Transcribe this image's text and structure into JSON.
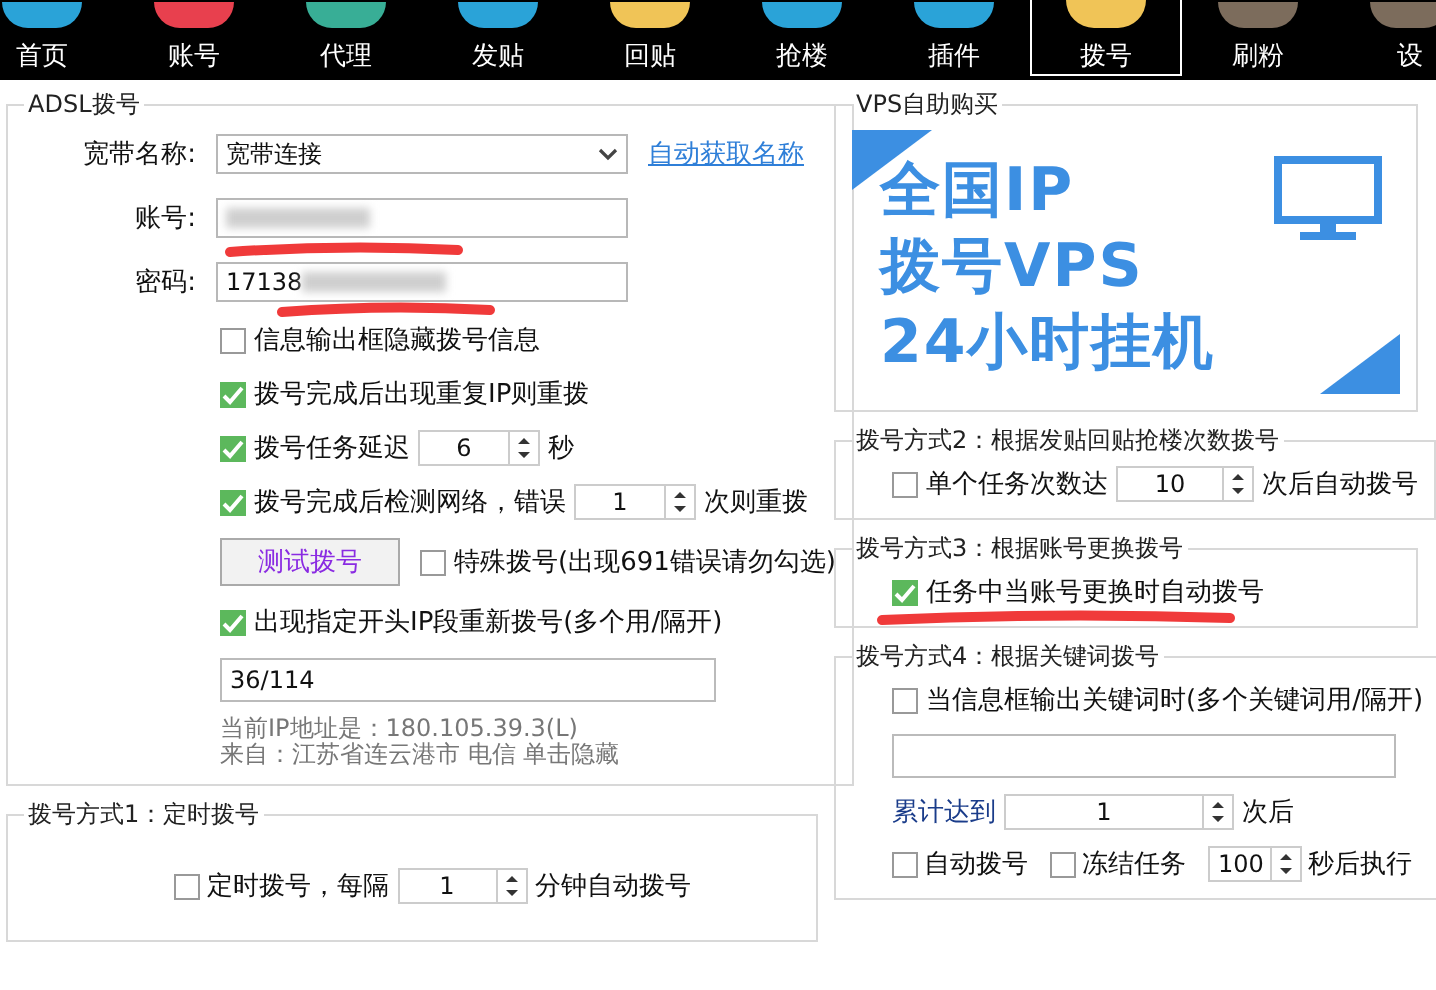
{
  "toolbar": {
    "items": [
      {
        "label": "首页",
        "color": "#2aa3d8",
        "selected": false
      },
      {
        "label": "账号",
        "color": "#e8404e",
        "selected": false
      },
      {
        "label": "代理",
        "color": "#38ae96",
        "selected": false
      },
      {
        "label": "发贴",
        "color": "#2aa3d8",
        "selected": false
      },
      {
        "label": "回贴",
        "color": "#f0c457",
        "selected": false
      },
      {
        "label": "抢楼",
        "color": "#2aa3d8",
        "selected": false
      },
      {
        "label": "插件",
        "color": "#2aa3d8",
        "selected": false
      },
      {
        "label": "拨号",
        "color": "#f0c457",
        "selected": true
      },
      {
        "label": "刷粉",
        "color": "#7c6c5c",
        "selected": false
      },
      {
        "label": "设",
        "color": "#7c6c5c",
        "selected": false
      }
    ]
  },
  "adsl": {
    "title": "ADSL拨号",
    "fields": [
      {
        "kind": "select",
        "label": "宽带名称:",
        "value": "宽带连接",
        "link": "自动获取名称"
      },
      {
        "kind": "text",
        "label": "账号:",
        "blurred": true,
        "marked": true
      },
      {
        "kind": "text",
        "label": "密码:",
        "value": "17138",
        "blurred": true,
        "marked": true
      }
    ],
    "options": [
      {
        "kind": "check",
        "label": "信息输出框隐藏拨号信息",
        "checked": false
      },
      {
        "kind": "check",
        "label": "拨号完成后出现重复IP则重拨",
        "checked": true
      },
      {
        "kind": "check_spin",
        "label": "拨号任务延迟",
        "checked": true,
        "value": "6",
        "suffix": "秒"
      },
      {
        "kind": "check_spin",
        "label": "拨号完成后检测网络，错误",
        "checked": true,
        "value": "1",
        "suffix": "次则重拨"
      },
      {
        "kind": "button_check",
        "button": "测试拨号",
        "label": "特殊拨号(出现691错误请勿勾选)",
        "checked": false
      },
      {
        "kind": "check",
        "label": "出现指定开头IP段重新拨号(多个用/隔开)",
        "checked": true
      },
      {
        "kind": "input",
        "value": "36/114"
      }
    ],
    "ip_info": [
      "当前IP地址是：180.105.39.3(L)",
      "来自：江苏省连云港市 电信   单击隐藏"
    ]
  },
  "method1": {
    "title": "拨号方式1：定时拨号",
    "options": [
      {
        "kind": "check_spin",
        "label": "定时拨号，每隔",
        "checked": false,
        "value": "1",
        "suffix": "分钟自动拨号"
      }
    ]
  },
  "vps": {
    "title": "VPS自助购买",
    "banner_lines": [
      "全国IP",
      "拨号VPS",
      "24小时挂机"
    ]
  },
  "method2": {
    "title": "拨号方式2：根据发贴回贴抢楼次数拨号",
    "options": [
      {
        "kind": "check_spin",
        "label": "单个任务次数达",
        "checked": false,
        "value": "10",
        "suffix": "次后自动拨号"
      }
    ]
  },
  "method3": {
    "title": "拨号方式3：根据账号更换拨号",
    "options": [
      {
        "kind": "check",
        "label": "任务中当账号更换时自动拨号",
        "checked": true,
        "marked": true
      }
    ]
  },
  "method4": {
    "title": "拨号方式4：根据关键词拨号",
    "options": [
      {
        "kind": "check",
        "label": "当信息框输出关键词时(多个关键词用/隔开)",
        "checked": false
      },
      {
        "kind": "input"
      },
      {
        "kind": "label_spin",
        "label": "累计达到",
        "value": "1",
        "suffix": "次后"
      },
      {
        "kind": "checks_spin",
        "checks": [
          {
            "label": "自动拨号",
            "checked": false
          },
          {
            "label": "冻结任务",
            "checked": false
          }
        ],
        "value": "100",
        "suffix": "秒后执行"
      }
    ]
  }
}
